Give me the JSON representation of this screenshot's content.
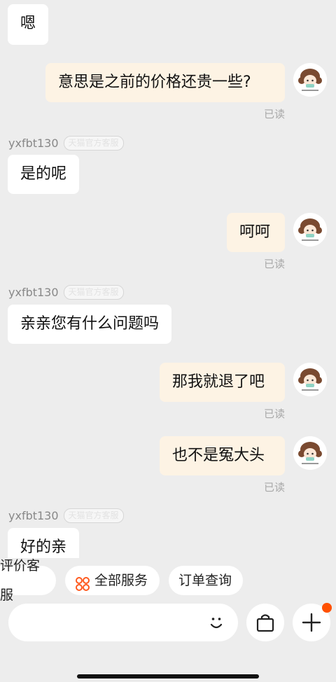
{
  "messages": {
    "m1": "嗯",
    "m2": "意思是之前的价格还贵一些?",
    "m3": "是的呢",
    "m4": "呵呵",
    "m5": "亲亲您有什么问题吗",
    "m6": "那我就退了吧",
    "m7": "也不是冤大头",
    "m8": "好的亲"
  },
  "read_label": "已读",
  "sender": {
    "name": "yxfbt130",
    "tag": "天猫官方客服"
  },
  "quick_actions": [
    "评价客服",
    "全部服务",
    "订单查询"
  ],
  "input": {
    "placeholder": ""
  },
  "icons": {
    "emoji": "smiley-icon",
    "cart": "shopping-bag-icon",
    "plus": "plus-icon"
  },
  "colors": {
    "background": "#ededed",
    "incoming_bubble": "#ffffff",
    "outgoing_bubble": "#fdf3e4",
    "notification_dot": "#ff5000",
    "service_icon": "#ff5a1f"
  }
}
